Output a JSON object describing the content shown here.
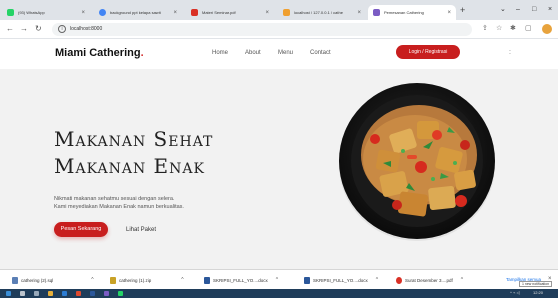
{
  "browser": {
    "tabs": [
      {
        "title": "(93) WhatsApp",
        "color": "#25d366"
      },
      {
        "title": "background ppt kelapa sawit",
        "color": "#4285f4"
      },
      {
        "title": "Materi Seminar.pdf",
        "color": "#d93025"
      },
      {
        "title": "localhost / 127.0.0.1 / cathe",
        "color": "#f0a030"
      },
      {
        "title": "Pemesanan Cathering",
        "color": "#7b5cc4"
      }
    ],
    "url": "localhost:8000"
  },
  "site": {
    "brand": "Miami Cathering",
    "brand_dot": ".",
    "nav": [
      "Home",
      "About",
      "Menu",
      "Contact"
    ],
    "login_button": "Login / Registrasi"
  },
  "hero": {
    "title_line1": "Makanan Sehat",
    "title_line2": "Makanan Enak",
    "desc_line1": "Nikmati makanan sehatmu sesuai dengan selera.",
    "desc_line2": "Kami meyediakan Makanan Enak namun berkualitas.",
    "cta_primary": "Pesan Sekarang",
    "cta_secondary": "Lihat Paket"
  },
  "downloads": {
    "items": [
      {
        "name": "cathering (2).sql",
        "color": "#5b7fb5"
      },
      {
        "name": "cathering (1).zip",
        "color": "#c9a227"
      },
      {
        "name": "SKRIPSI_FULL_YO....docx",
        "color": "#2b579a"
      },
      {
        "name": "SKRIPSI_FULL_YO....docx",
        "color": "#2b579a"
      },
      {
        "name": "Surat Desember 3....pdf",
        "color": "#d93025"
      }
    ],
    "show_all": "Tampilkan semua",
    "tooltip": "1 new notification"
  },
  "taskbar": {
    "time": "12:20"
  },
  "colors": {
    "accent": "#c81e1e",
    "hero_bg": "#f2f2f2"
  }
}
